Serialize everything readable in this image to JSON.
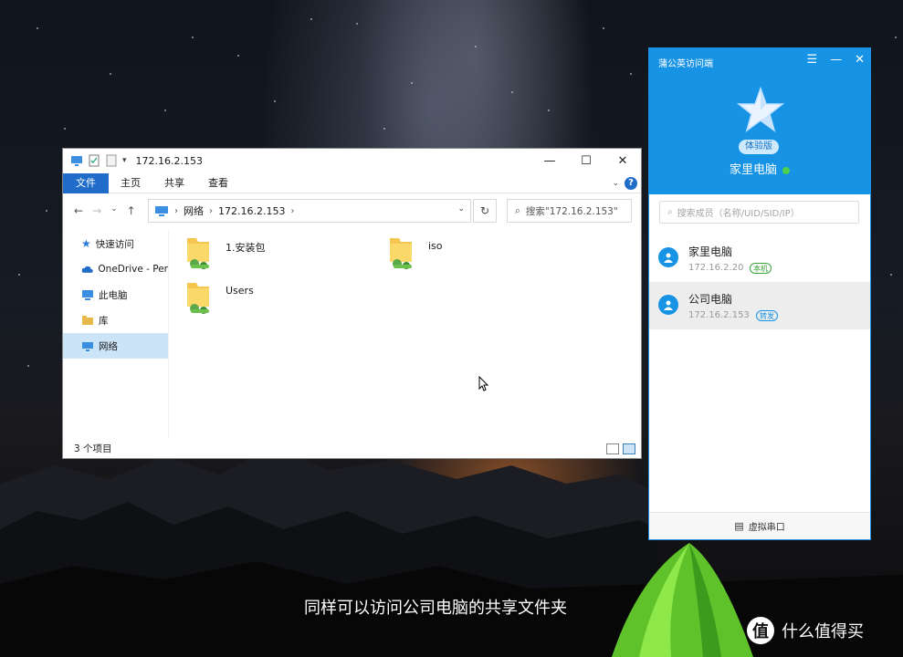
{
  "explorer": {
    "title": "172.16.2.153",
    "ribbon_tabs": [
      "文件",
      "主页",
      "共享",
      "查看"
    ],
    "breadcrumb": [
      "网络",
      "172.16.2.153"
    ],
    "search_placeholder": "搜索\"172.16.2.153\"",
    "nav_items": [
      {
        "label": "快速访问",
        "icon": "star-icon"
      },
      {
        "label": "OneDrive - Per",
        "icon": "cloud-icon"
      },
      {
        "label": "此电脑",
        "icon": "computer-icon"
      },
      {
        "label": "库",
        "icon": "library-icon"
      },
      {
        "label": "网络",
        "icon": "network-icon",
        "selected": true
      }
    ],
    "files": [
      {
        "name": "1.安装包",
        "icon": "shared-folder-icon"
      },
      {
        "name": "iso",
        "icon": "shared-folder-icon"
      },
      {
        "name": "Users",
        "icon": "shared-folder-icon"
      }
    ],
    "status": "3 个项目"
  },
  "pugongying": {
    "title": "蒲公英访问端",
    "edition_badge": "体验版",
    "device_name": "家里电脑",
    "online": true,
    "search_placeholder": "搜索成员（名称/UID/SID/IP）",
    "members": [
      {
        "name": "家里电脑",
        "ip": "172.16.2.20",
        "tag": "本机"
      },
      {
        "name": "公司电脑",
        "ip": "172.16.2.153",
        "tag": "转发",
        "selected": true
      }
    ],
    "footer": "虚拟串口"
  },
  "subtitle": "同样可以访问公司电脑的共享文件夹",
  "watermark": {
    "logo": "值",
    "text": "什么值得买"
  },
  "colors": {
    "accent": "#1793e6",
    "ribbon_file": "#1f6cc9",
    "online_dot": "#4fd04f",
    "tent": "#7ee23a"
  }
}
